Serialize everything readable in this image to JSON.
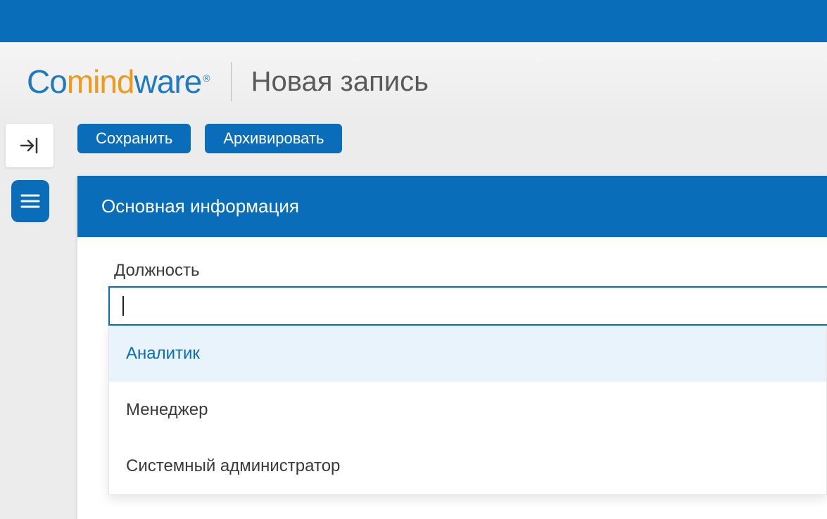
{
  "logo": {
    "part1": "Co",
    "part2": "mind",
    "part3": "ware",
    "reg": "®"
  },
  "page_title": "Новая запись",
  "toolbar": {
    "save": "Сохранить",
    "archive": "Архивировать"
  },
  "panel": {
    "header": "Основная информация"
  },
  "field": {
    "label": "Должность",
    "options": [
      "Аналитик",
      "Менеджер",
      "Системный администратор"
    ]
  }
}
